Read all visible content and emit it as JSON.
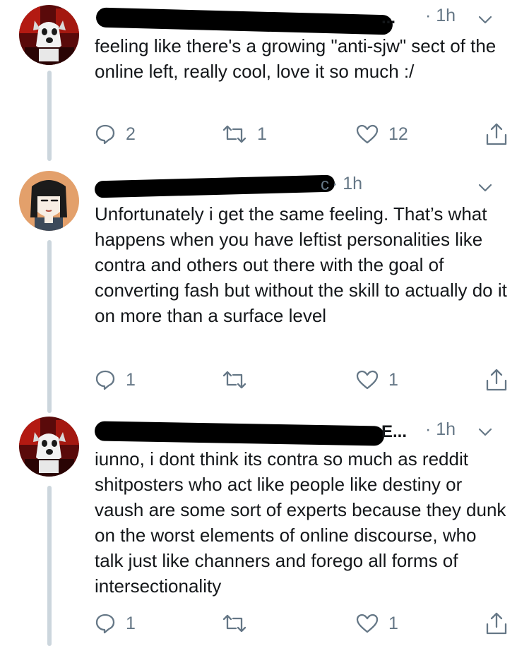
{
  "tweets": [
    {
      "name_fragment": "...",
      "time": "· 1h",
      "text": "feeling like there's a growing \"anti-sjw\" sect of the online left, really cool, love it so much :/",
      "replies": "2",
      "retweets": "1",
      "likes": "12"
    },
    {
      "name_fragment": "c",
      "time": "· 1h",
      "text": "Unfortunately i get the same feeling. That’s what happens when you have leftist personalities like contra and others out there with the goal of converting fash but without the skill to actually do it on more than a surface level",
      "replies": "1",
      "retweets": "",
      "likes": "1"
    },
    {
      "name_fragment": "E...",
      "time": "· 1h",
      "text": "iunno, i dont think its contra so much as reddit shitposters who act like people like destiny or vaush are some sort of experts because they dunk on the worst elements of online discourse, who talk just like channers and forego all forms of intersectionality",
      "replies": "1",
      "retweets": "",
      "likes": "1"
    }
  ],
  "icons": {
    "reply": "reply-bubble-icon",
    "retweet": "retweet-icon",
    "like": "heart-icon",
    "share": "share-icon",
    "caret": "chevron-down-icon"
  },
  "colors": {
    "text": "#14171a",
    "muted": "#657786",
    "thread_line": "#ccd6dd"
  }
}
